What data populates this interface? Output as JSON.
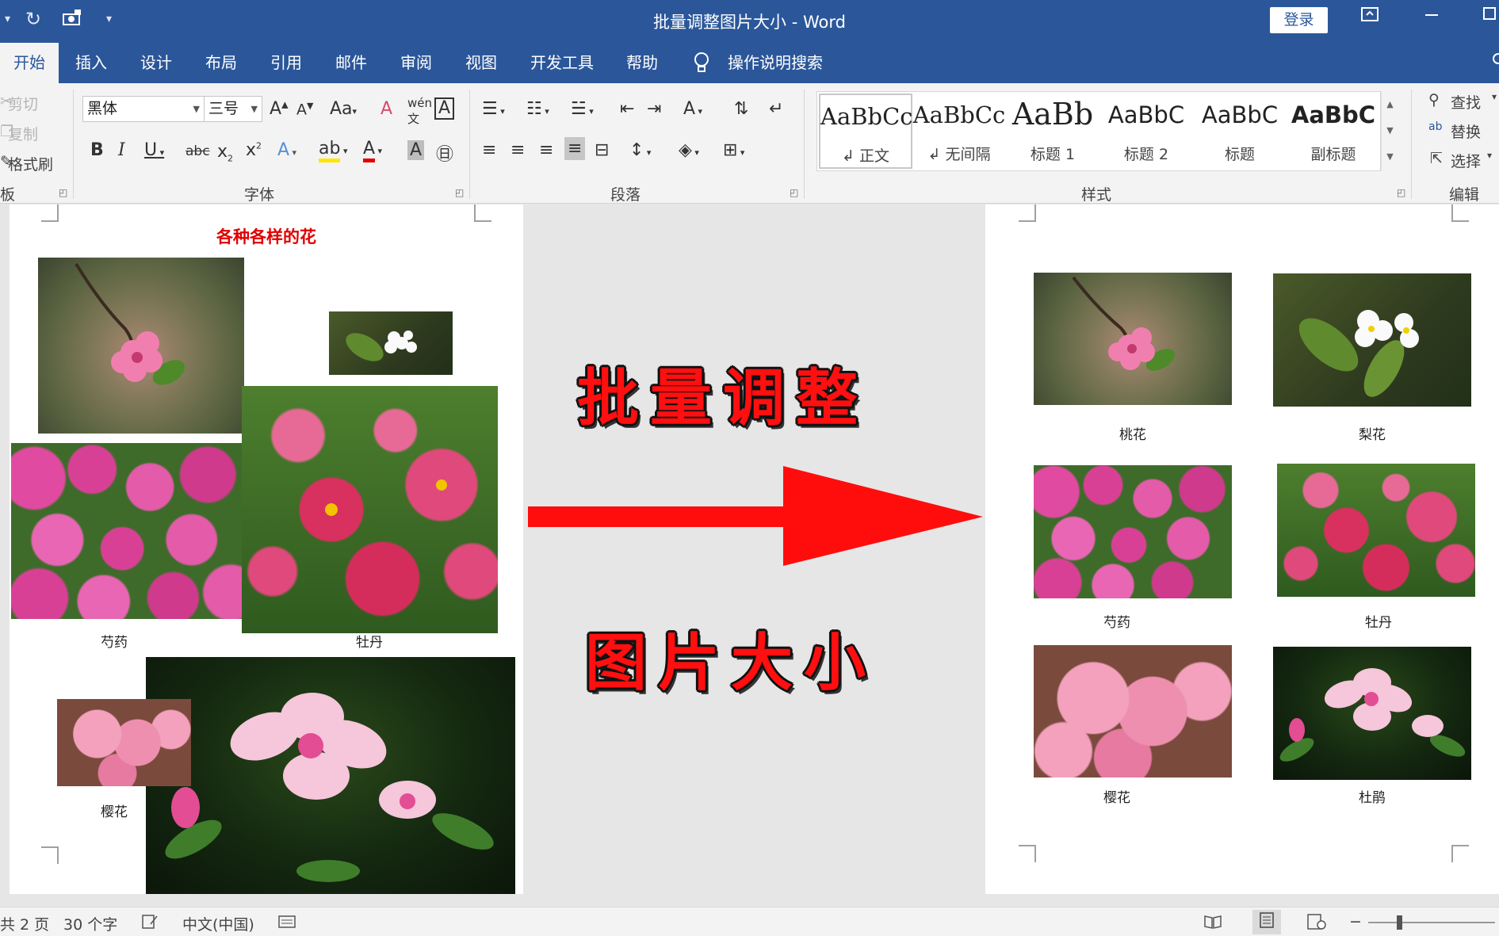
{
  "window": {
    "title": "批量调整图片大小  -  Word",
    "login_label": "登录"
  },
  "quick_access": {
    "undo_dropdown": "▾",
    "redo": "↻",
    "customize": "▾"
  },
  "tabs": [
    "开始",
    "插入",
    "设计",
    "布局",
    "引用",
    "邮件",
    "审阅",
    "视图",
    "开发工具",
    "帮助"
  ],
  "tell_me": "操作说明搜索",
  "clipboard": {
    "cut": "剪切",
    "copy": "复制",
    "format_painter": "格式刷",
    "group_label": "板"
  },
  "font": {
    "name": "黑体",
    "size": "三号",
    "group_label": "字体"
  },
  "paragraph": {
    "group_label": "段落"
  },
  "styles": {
    "group_label": "样式",
    "items": [
      {
        "sample": "AaBbCc",
        "name": "↲ 正文"
      },
      {
        "sample": "AaBbCc",
        "name": "↲ 无间隔"
      },
      {
        "sample": "AaBb",
        "name": "标题 1"
      },
      {
        "sample": "AaBbC",
        "name": "标题 2"
      },
      {
        "sample": "AaBbC",
        "name": "标题"
      },
      {
        "sample": "AaBbC",
        "name": "副标题"
      }
    ]
  },
  "editing": {
    "find": "查找",
    "replace": "替换",
    "select": "选择",
    "group_label": "编辑"
  },
  "left_page": {
    "heading": "各种各样的花",
    "captions": {
      "shaoyao": "芍药",
      "mudan": "牡丹",
      "yinghua": "樱花"
    }
  },
  "center": {
    "line1": "批量调整",
    "line2": "图片大小"
  },
  "right_page": {
    "captions": {
      "taohua": "桃花",
      "lihua": "梨花",
      "shaoyao": "芍药",
      "mudan": "牡丹",
      "yinghua": "樱花",
      "dujuan": "杜鹃"
    }
  },
  "status": {
    "page": "共 2 页",
    "words": "30 个字",
    "language": "中文(中国)"
  },
  "colors": {
    "word_blue": "#2b579a",
    "arrow_red": "#ff0d0d",
    "heading_red": "#e00000"
  }
}
